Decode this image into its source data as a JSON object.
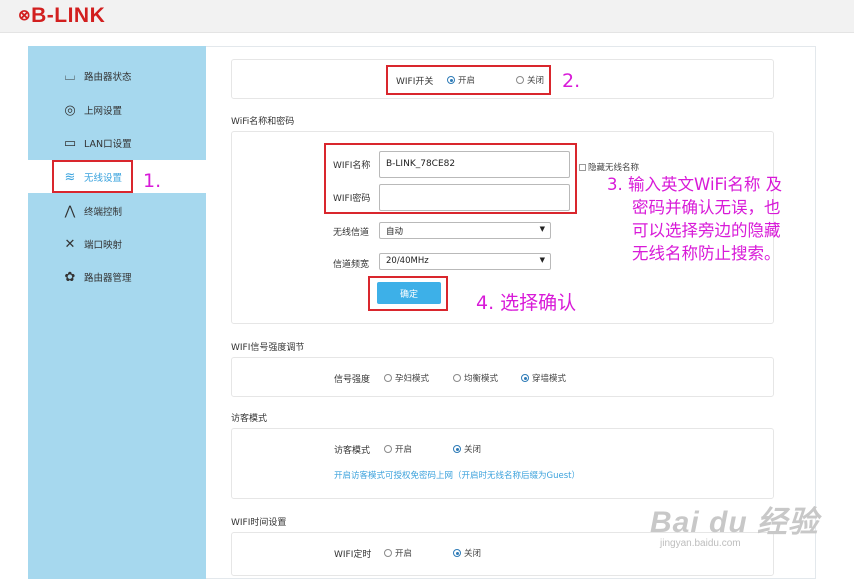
{
  "header": {
    "logo_text": "B-LINK"
  },
  "sidebar": {
    "items": [
      {
        "label": "路由器状态",
        "icon": "router-status-icon",
        "glyph": "⌴"
      },
      {
        "label": "上网设置",
        "icon": "globe-icon",
        "glyph": "◎"
      },
      {
        "label": "LAN口设置",
        "icon": "monitor-icon",
        "glyph": "▭"
      },
      {
        "label": "无线设置",
        "icon": "wifi-icon",
        "glyph": "≋",
        "active": true
      },
      {
        "label": "终端控制",
        "icon": "terminal-control-icon",
        "glyph": "⋀"
      },
      {
        "label": "端口映射",
        "icon": "tools-icon",
        "glyph": "✕"
      },
      {
        "label": "路由器管理",
        "icon": "gear-icon",
        "glyph": "✿"
      }
    ]
  },
  "wifi_switch": {
    "label": "WIFI开关",
    "on_label": "开启",
    "off_label": "关闭",
    "selected": "on"
  },
  "name_pwd": {
    "section_title": "WiFi名称和密码",
    "name_label": "WIFI名称",
    "name_value": "B-LINK_78CE82",
    "hide_label": "隐藏无线名称",
    "pwd_label": "WIFI密码",
    "pwd_value": "",
    "channel_label": "无线信道",
    "channel_value": "自动",
    "bandwidth_label": "信道频宽",
    "bandwidth_value": "20/40MHz",
    "confirm_label": "确定"
  },
  "signal": {
    "section_title": "WIFI信号强度调节",
    "label": "信号强度",
    "options": [
      "孕妇模式",
      "均衡模式",
      "穿墙模式"
    ],
    "selected_index": 2
  },
  "guest": {
    "section_title": "访客模式",
    "label": "访客模式",
    "on_label": "开启",
    "off_label": "关闭",
    "selected": "off",
    "hint": "开启访客模式可授权免密码上网（开启时无线名称后缀为Guest）"
  },
  "timer": {
    "section_title": "WIFI时间设置",
    "label": "WIFI定时",
    "on_label": "开启",
    "off_label": "关闭",
    "selected": "off"
  },
  "annotations": {
    "step1": "1.",
    "step2": "2.",
    "step3_lines": [
      "3. 输入英文WiFi名称 及",
      "密码并确认无误，也",
      "可以选择旁边的隐藏",
      "无线名称防止搜索。"
    ],
    "step4": "4.  选择确认"
  },
  "watermark": {
    "main": "Bai du 经验",
    "sub": "jingyan.baidu.com"
  },
  "colors": {
    "accent": "#3db0e8",
    "sidebar_bg": "#a6d8ee",
    "annotation": "#d81ad8",
    "highlight_box": "#d9262d",
    "logo": "#d21f1f"
  }
}
